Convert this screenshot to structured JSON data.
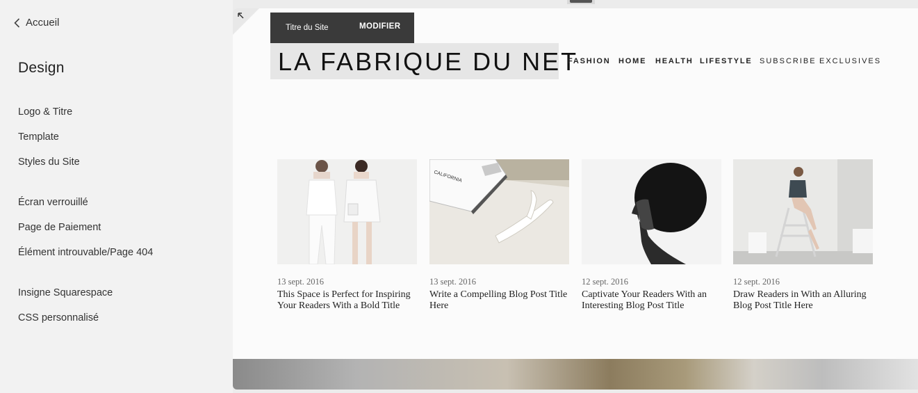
{
  "sidebar": {
    "back_label": "Accueil",
    "title": "Design",
    "items": [
      {
        "label": "Logo & Titre"
      },
      {
        "label": "Template"
      },
      {
        "label": "Styles du Site"
      },
      {
        "label": "Écran verrouillé"
      },
      {
        "label": "Page de Paiement"
      },
      {
        "label": "Élément introuvable/Page 404"
      },
      {
        "label": "Insigne Squarespace"
      },
      {
        "label": "CSS personnalisé"
      }
    ]
  },
  "edit_bar": {
    "label": "Titre du Site",
    "button": "MODIFIER"
  },
  "site": {
    "title": "LA FABRIQUE DU NET",
    "nav": [
      {
        "label": "FASHION"
      },
      {
        "label": "HOME"
      },
      {
        "label": "HEALTH"
      },
      {
        "label": "LIFESTYLE"
      },
      {
        "label": "SUBSCRIBE"
      },
      {
        "label": "EXCLUSIVES"
      }
    ]
  },
  "posts": [
    {
      "date": "13 sept. 2016",
      "title": "This Space is Perfect for Inspiring Your Readers With a Bold Title"
    },
    {
      "date": "13 sept. 2016",
      "title": "Write a Compelling Blog Post Title Here"
    },
    {
      "date": "12 sept. 2016",
      "title": "Captivate Your Readers With an Interesting Blog Post Title"
    },
    {
      "date": "12 sept. 2016",
      "title": "Draw Readers in With an Alluring Blog Post Title Here"
    }
  ],
  "book_cover_text": "CALIFORNIA SURFING AND CLIMBING IN THE FIFTIES"
}
